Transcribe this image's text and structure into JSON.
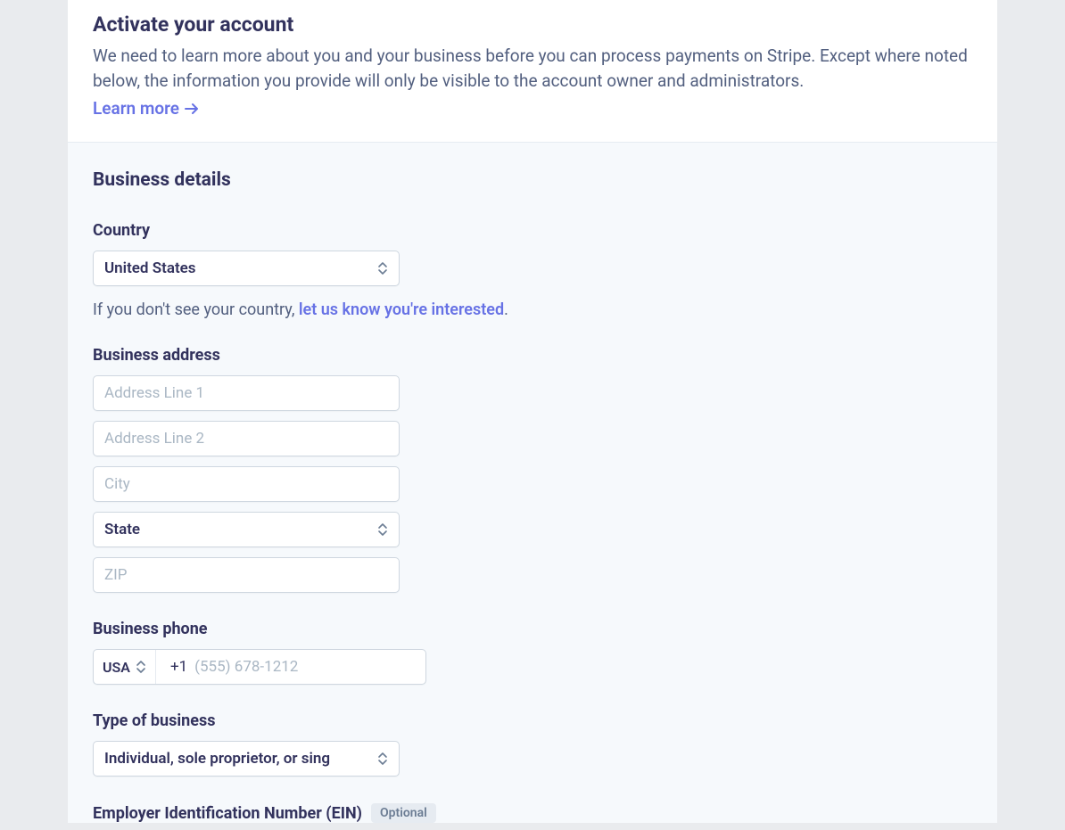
{
  "header": {
    "title": "Activate your account",
    "description": "We need to learn more about you and your business before you can process payments on Stripe. Except where noted below, the information you provide will only be visible to the account owner and administrators.",
    "learn_more_label": "Learn more"
  },
  "business_details": {
    "section_title": "Business details",
    "country": {
      "label": "Country",
      "value": "United States",
      "hint_prefix": "If you don't see your country, ",
      "hint_link": "let us know you're interested",
      "hint_suffix": "."
    },
    "address": {
      "label": "Business address",
      "line1_placeholder": "Address Line 1",
      "line2_placeholder": "Address Line 2",
      "city_placeholder": "City",
      "state_value": "State",
      "zip_placeholder": "ZIP"
    },
    "phone": {
      "label": "Business phone",
      "country_code_label": "USA",
      "prefix": "+1",
      "placeholder": "(555) 678-1212"
    },
    "business_type": {
      "label": "Type of business",
      "value": "Individual, sole proprietor, or sing"
    },
    "ein": {
      "label": "Employer Identification Number (EIN)",
      "optional_label": "Optional"
    }
  }
}
